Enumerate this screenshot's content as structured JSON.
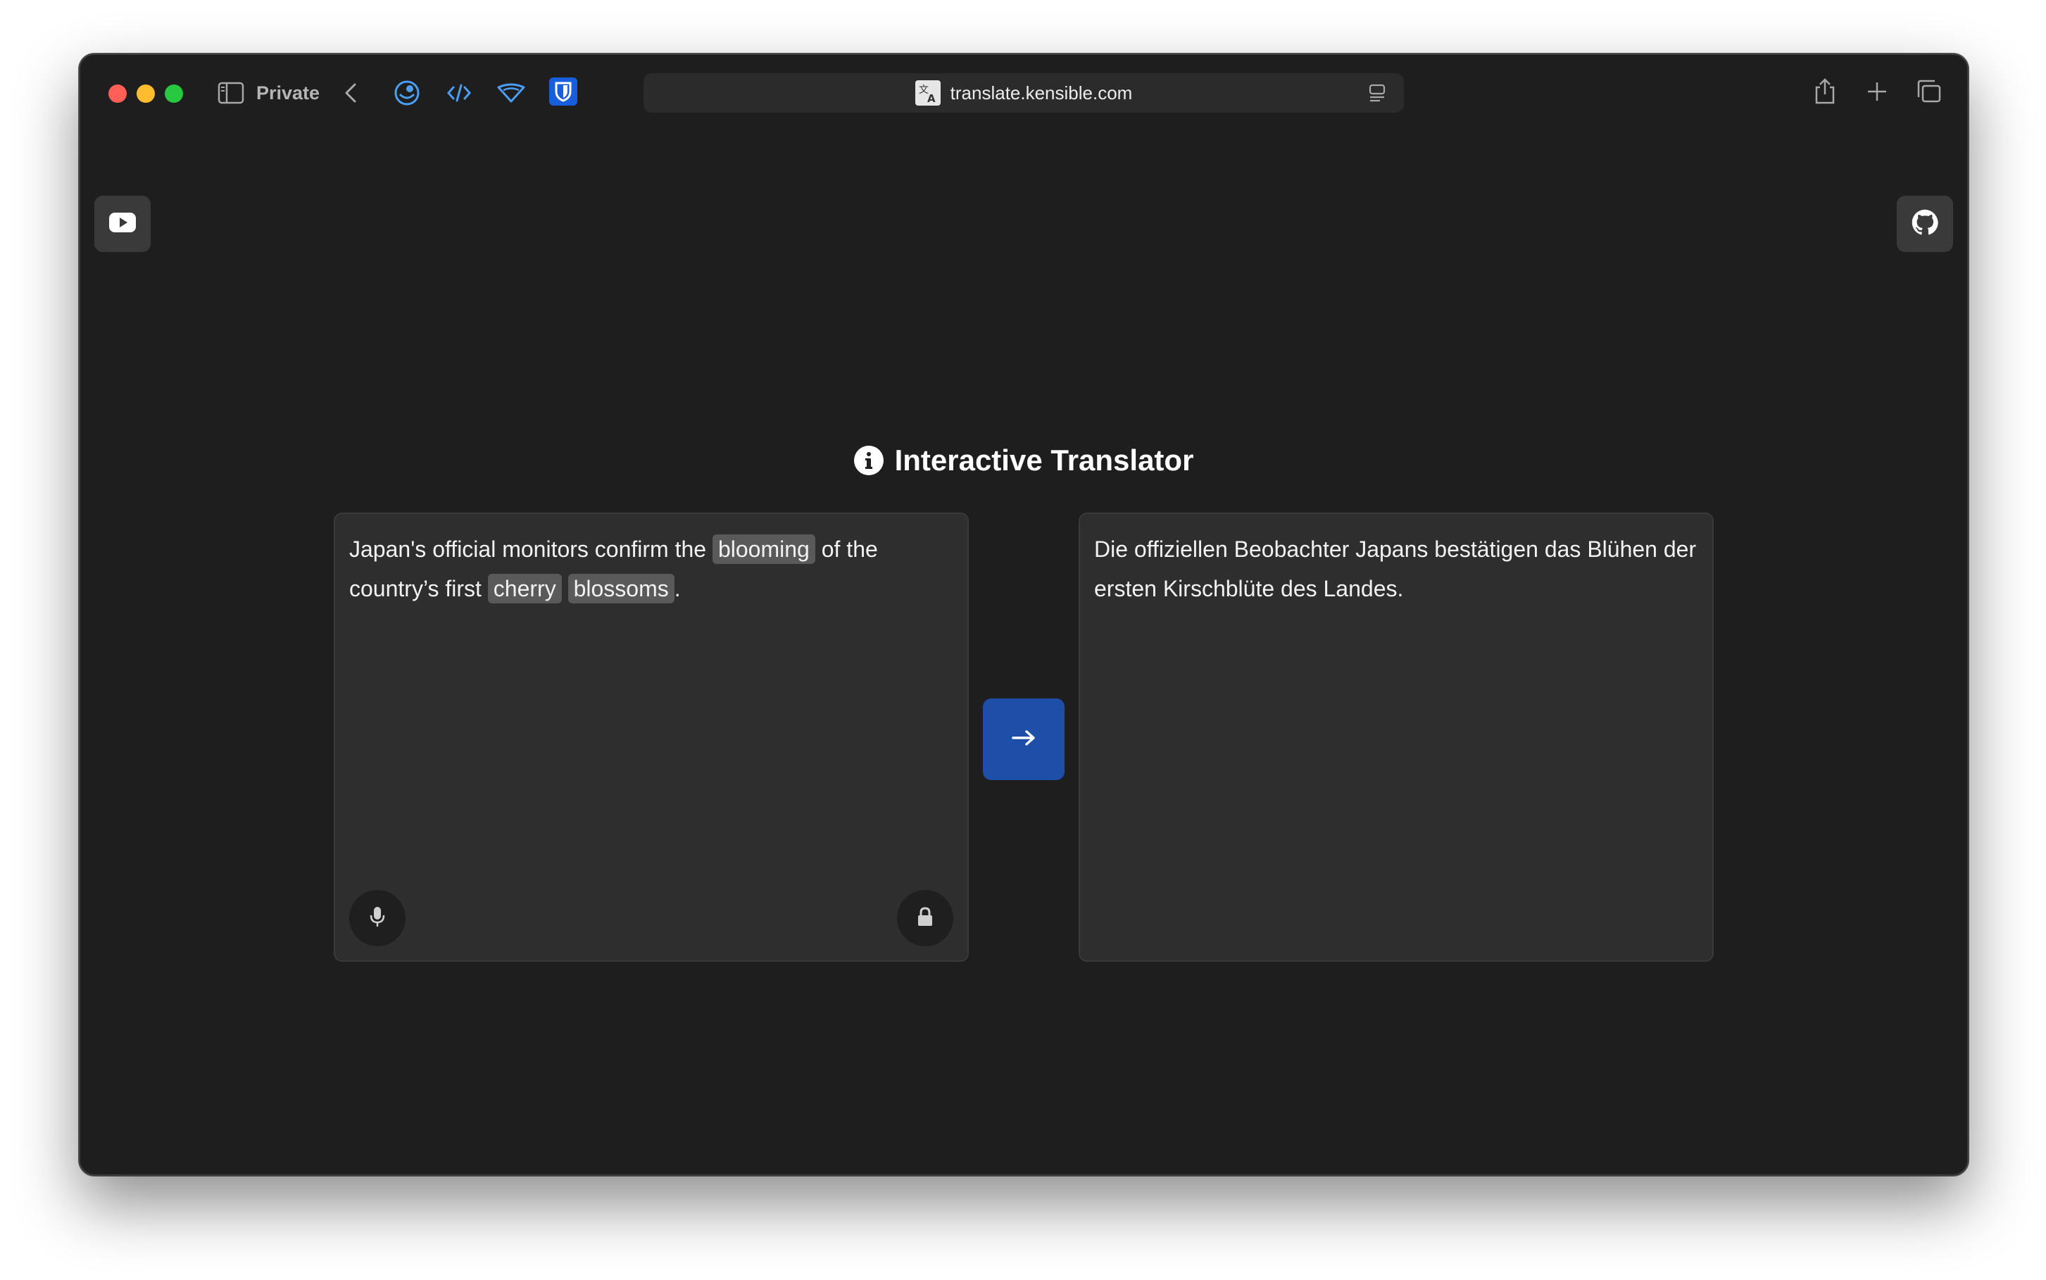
{
  "browser": {
    "private_label": "Private",
    "url": "translate.kensible.com"
  },
  "page": {
    "title": "Interactive Translator",
    "source": {
      "segments": [
        {
          "text": "Japan's official monitors confirm the ",
          "highlight": false
        },
        {
          "text": "blooming",
          "highlight": true
        },
        {
          "text": " of the country’s first ",
          "highlight": false
        },
        {
          "text": "cherry",
          "highlight": true
        },
        {
          "text": " ",
          "highlight": false
        },
        {
          "text": "blossoms",
          "highlight": true
        },
        {
          "text": ".",
          "highlight": false
        }
      ]
    },
    "target": {
      "text": "Die offiziellen Beobachter Japans bestätigen das Blühen der ersten Kirschblüte des Landes."
    }
  },
  "colors": {
    "accent": "#1e4fa8",
    "highlight": "#5a5a5a",
    "background": "#1e1e1e",
    "panel": "#2e2e2e"
  },
  "icons": [
    "sidebar-icon",
    "chevron-left-icon",
    "extension-icon",
    "code-icon",
    "wifi-icon",
    "bitwarden-shield-icon",
    "translate-icon",
    "reader-icon",
    "share-icon",
    "plus-icon",
    "tabs-icon",
    "youtube-icon",
    "github-icon",
    "info-icon",
    "microphone-icon",
    "lock-icon",
    "arrow-right-icon"
  ]
}
